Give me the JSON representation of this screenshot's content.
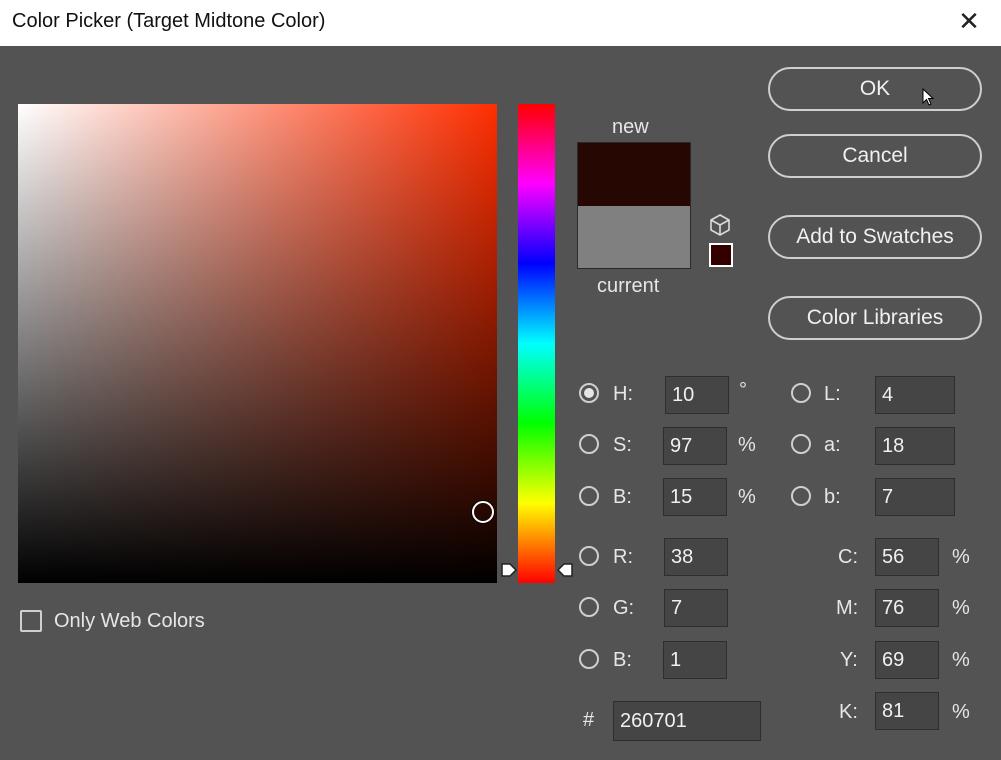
{
  "window": {
    "title": "Color Picker (Target Midtone Color)",
    "close_glyph": "✕"
  },
  "buttons": {
    "ok": "OK",
    "cancel": "Cancel",
    "add_to_swatches": "Add to Swatches",
    "color_libraries": "Color Libraries"
  },
  "preview": {
    "new_label": "new",
    "current_label": "current",
    "new_color": "#260701",
    "current_color": "#808080"
  },
  "hsb": {
    "h": {
      "label": "H:",
      "value": "10",
      "unit": "°",
      "selected": true
    },
    "s": {
      "label": "S:",
      "value": "97",
      "unit": "%"
    },
    "b": {
      "label": "B:",
      "value": "15",
      "unit": "%"
    }
  },
  "lab": {
    "l": {
      "label": "L:",
      "value": "4"
    },
    "a": {
      "label": "a:",
      "value": "18"
    },
    "b": {
      "label": "b:",
      "value": "7"
    }
  },
  "rgb": {
    "r": {
      "label": "R:",
      "value": "38"
    },
    "g": {
      "label": "G:",
      "value": "7"
    },
    "b": {
      "label": "B:",
      "value": "1"
    }
  },
  "cmyk": {
    "c": {
      "label": "C:",
      "value": "56",
      "unit": "%"
    },
    "m": {
      "label": "M:",
      "value": "76",
      "unit": "%"
    },
    "y": {
      "label": "Y:",
      "value": "69",
      "unit": "%"
    },
    "k": {
      "label": "K:",
      "value": "81",
      "unit": "%"
    }
  },
  "hex": {
    "label": "#",
    "value": "260701"
  },
  "web_colors": {
    "label": "Only Web Colors",
    "checked": false
  },
  "colors": {
    "pure_hue": "#ff2e00",
    "background": "#535353"
  },
  "icons": {
    "gamut": "out-of-gamut-cube-icon",
    "websafe": "web-safe-swatch-icon"
  }
}
